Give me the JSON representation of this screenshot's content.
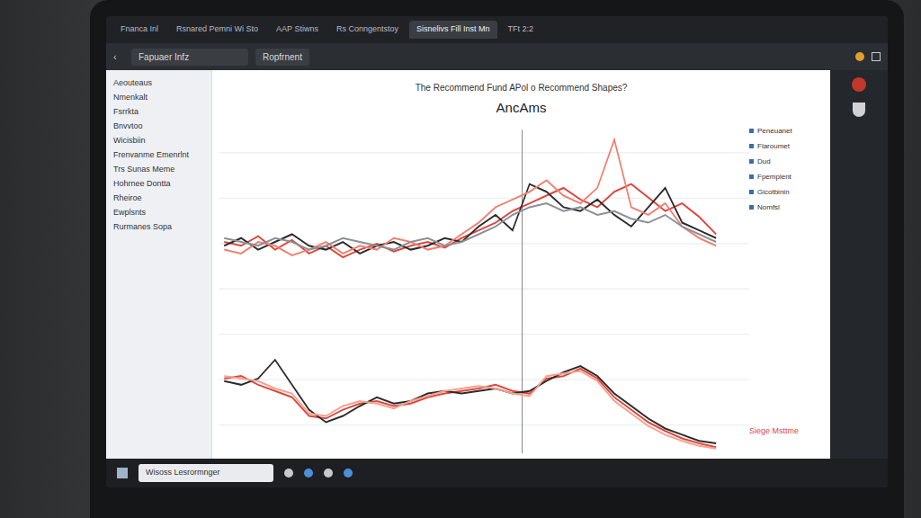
{
  "browser": {
    "tabs": [
      {
        "label": "Fnanca Inl",
        "selected": false
      },
      {
        "label": "Rsnared Pemni Wi Sto",
        "selected": false
      },
      {
        "label": "AAP Stiwns",
        "selected": false
      },
      {
        "label": "Rs Conngentstoy",
        "selected": false
      },
      {
        "label": "Sisnelivs Fill Inst Mn",
        "selected": true
      },
      {
        "label": "TFt 2:2",
        "selected": false
      }
    ],
    "address": "Fapuaer Infz",
    "button": "Ropfrnent"
  },
  "sidebar": {
    "items": [
      "Aeouteaus",
      "Nmenkalt",
      "Fsrrkta",
      "Bnvvtoo",
      "Wicisbiin",
      "Frenvanme Emenrlnt",
      "Trs Sunas Meme",
      "Hohrnee Dontta",
      "Rheiroe",
      "Ewplsnts",
      "Rurmanes Sopa"
    ]
  },
  "chart": {
    "title": "The Recommend Fund APol o Recommend Shapes?",
    "subtitle": "AncAms",
    "upper": [
      {
        "name": "red",
        "color": "#e0453a",
        "values": [
          42,
          40,
          45,
          38,
          43,
          36,
          40,
          34,
          38,
          41,
          37,
          40,
          42,
          39,
          44,
          48,
          52,
          58,
          62,
          66,
          70,
          64,
          60,
          68,
          72,
          65,
          58,
          62,
          55,
          46
        ]
      },
      {
        "name": "dark",
        "color": "#2b2b2b",
        "values": [
          40,
          44,
          38,
          42,
          46,
          40,
          38,
          42,
          36,
          40,
          42,
          38,
          40,
          44,
          42,
          50,
          56,
          48,
          72,
          68,
          60,
          58,
          64,
          56,
          50,
          60,
          70,
          52,
          48,
          44
        ]
      },
      {
        "name": "light red",
        "color": "#f08070",
        "values": [
          38,
          36,
          42,
          40,
          35,
          38,
          42,
          36,
          40,
          38,
          44,
          42,
          38,
          40,
          46,
          52,
          60,
          64,
          68,
          74,
          66,
          62,
          70,
          95,
          60,
          56,
          62,
          50,
          44,
          40
        ]
      },
      {
        "name": "gray",
        "color": "#8a8f96",
        "values": [
          44,
          42,
          40,
          44,
          42,
          38,
          40,
          44,
          42,
          40,
          38,
          42,
          44,
          40,
          42,
          46,
          50,
          56,
          60,
          62,
          58,
          60,
          56,
          58,
          54,
          52,
          56,
          50,
          46,
          42
        ]
      }
    ],
    "lower": [
      {
        "name": "red",
        "color": "#e0453a",
        "values": [
          60,
          62,
          55,
          50,
          45,
          30,
          28,
          35,
          40,
          42,
          38,
          40,
          45,
          48,
          50,
          52,
          55,
          50,
          48,
          60,
          62,
          68,
          60,
          45,
          35,
          25,
          18,
          12,
          8,
          5
        ]
      },
      {
        "name": "dark",
        "color": "#2b2b2b",
        "values": [
          58,
          55,
          60,
          75,
          55,
          35,
          25,
          30,
          38,
          45,
          40,
          42,
          48,
          50,
          48,
          50,
          52,
          48,
          50,
          58,
          65,
          70,
          62,
          48,
          38,
          28,
          20,
          15,
          10,
          8
        ]
      },
      {
        "name": "light red",
        "color": "#f4a090",
        "values": [
          62,
          60,
          58,
          52,
          48,
          32,
          30,
          38,
          42,
          40,
          36,
          42,
          46,
          50,
          52,
          54,
          52,
          48,
          46,
          62,
          64,
          66,
          58,
          42,
          32,
          22,
          15,
          10,
          6,
          4
        ]
      }
    ],
    "legend": [
      "Peneuanet",
      "Flaroumet",
      "Dud",
      "Fpemplent",
      "Gicotbinin",
      "Nomfsl"
    ],
    "note": "Siege Msttme"
  },
  "taskbar": {
    "search": "Wisoss Lesrormnger"
  }
}
